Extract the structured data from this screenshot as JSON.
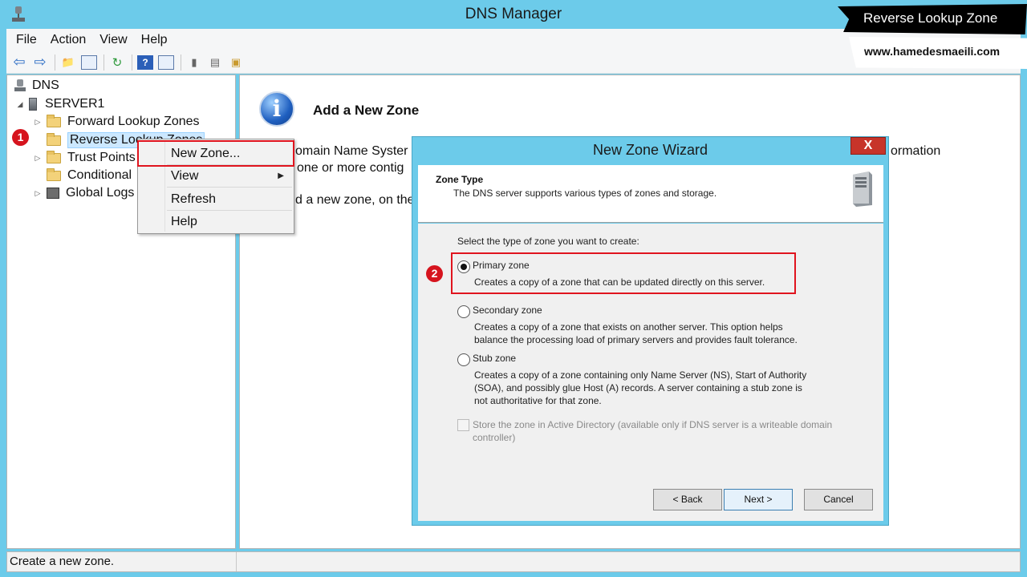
{
  "window": {
    "title": "DNS Manager"
  },
  "menu": [
    "File",
    "Action",
    "View",
    "Help"
  ],
  "tree": {
    "root": "DNS",
    "server": "SERVER1",
    "items": [
      "Forward Lookup Zones",
      "Reverse Lookup Zones",
      "Trust Points",
      "Conditional",
      "Global Logs"
    ]
  },
  "context_menu": {
    "items": [
      "New Zone...",
      "View",
      "Refresh",
      "Help"
    ]
  },
  "right_pane": {
    "title": "Add a New Zone",
    "line1": "omain Name Syster",
    "line2": "one or more contig",
    "line3": "d a new zone, on the",
    "line_right": "ormation"
  },
  "wizard": {
    "title": "New Zone Wizard",
    "close": "X",
    "header_title": "Zone Type",
    "header_subtitle": "The DNS server supports various types of zones and storage.",
    "prompt": "Select the type of zone you want to create:",
    "primary_label": "Primary zone",
    "primary_desc": "Creates a copy of a zone that can be updated directly on this server.",
    "secondary_label": "Secondary zone",
    "secondary_desc_1": "Creates a copy of a zone that exists on another server. This option helps",
    "secondary_desc_2": "balance the processing load of primary servers and provides fault tolerance.",
    "stub_label": "Stub zone",
    "stub_desc_1": "Creates a copy of a zone containing only Name Server (NS), Start of Authority",
    "stub_desc_2": "(SOA), and possibly glue Host (A) records. A server containing a stub zone is",
    "stub_desc_3": "not authoritative for that zone.",
    "ad_label_1": "Store the zone in Active Directory (available only if DNS server is a writeable domain",
    "ad_label_2": "controller)",
    "back": "< Back",
    "next": "Next >",
    "cancel": "Cancel",
    "selected": "Primary zone"
  },
  "steps": {
    "one": "1",
    "two": "2"
  },
  "status": {
    "text": "Create a new zone."
  },
  "watermark": {
    "title": "Reverse Lookup Zone",
    "site": "www.hamedesmaeili.com"
  },
  "colors": {
    "chrome": "#6ccbea",
    "highlight": "#e0141e",
    "close": "#c7342a"
  }
}
